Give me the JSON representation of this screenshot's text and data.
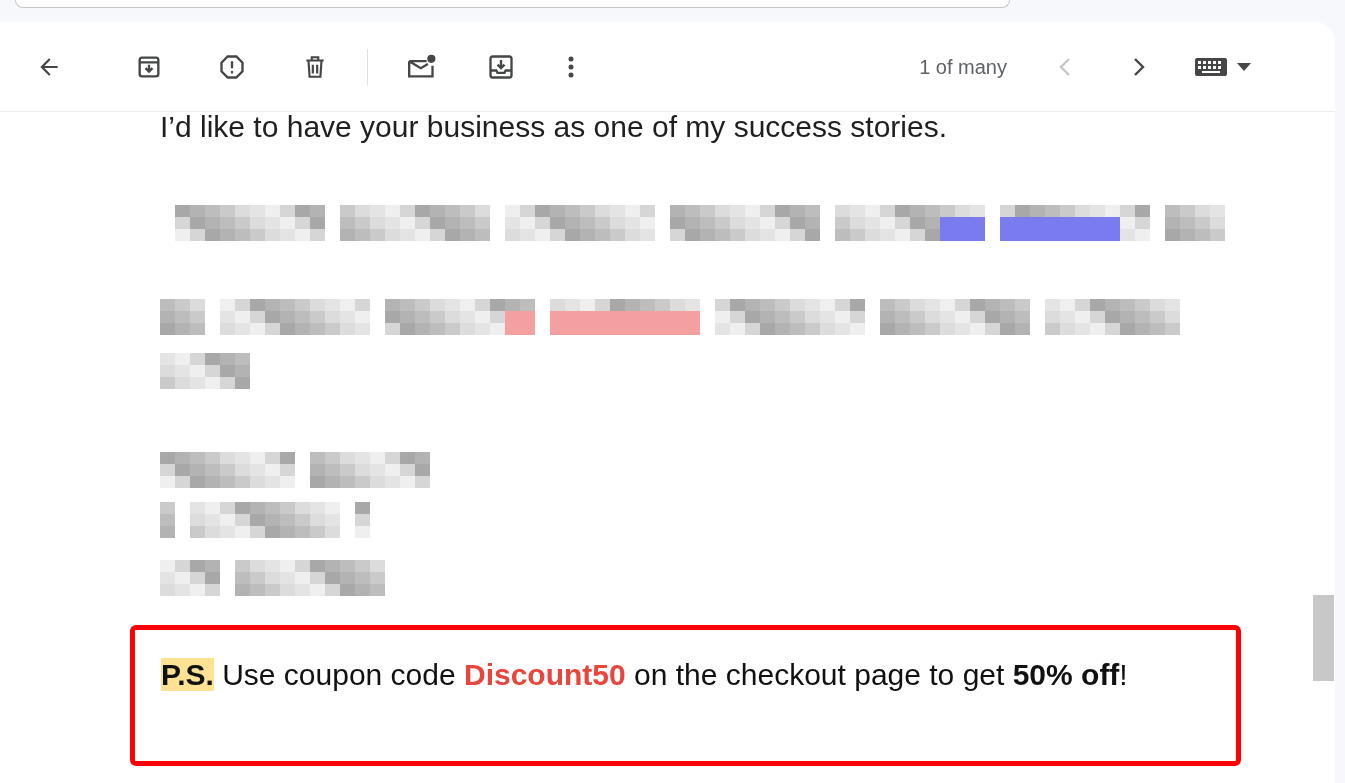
{
  "toolbar": {
    "counter": "1 of many",
    "newer_disabled": true,
    "older_disabled": false
  },
  "message": {
    "intro": "I’d like to have your business as one of my success stories.",
    "postscript": [
      {
        "kind": "highlight",
        "text": "P.S."
      },
      {
        "kind": "plain",
        "text": " Use coupon code "
      },
      {
        "kind": "code",
        "text": "Discount50"
      },
      {
        "kind": "plain",
        "text": " on the checkout page to get "
      },
      {
        "kind": "bold",
        "text": "50% off"
      },
      {
        "kind": "plain",
        "text": "!"
      }
    ]
  }
}
